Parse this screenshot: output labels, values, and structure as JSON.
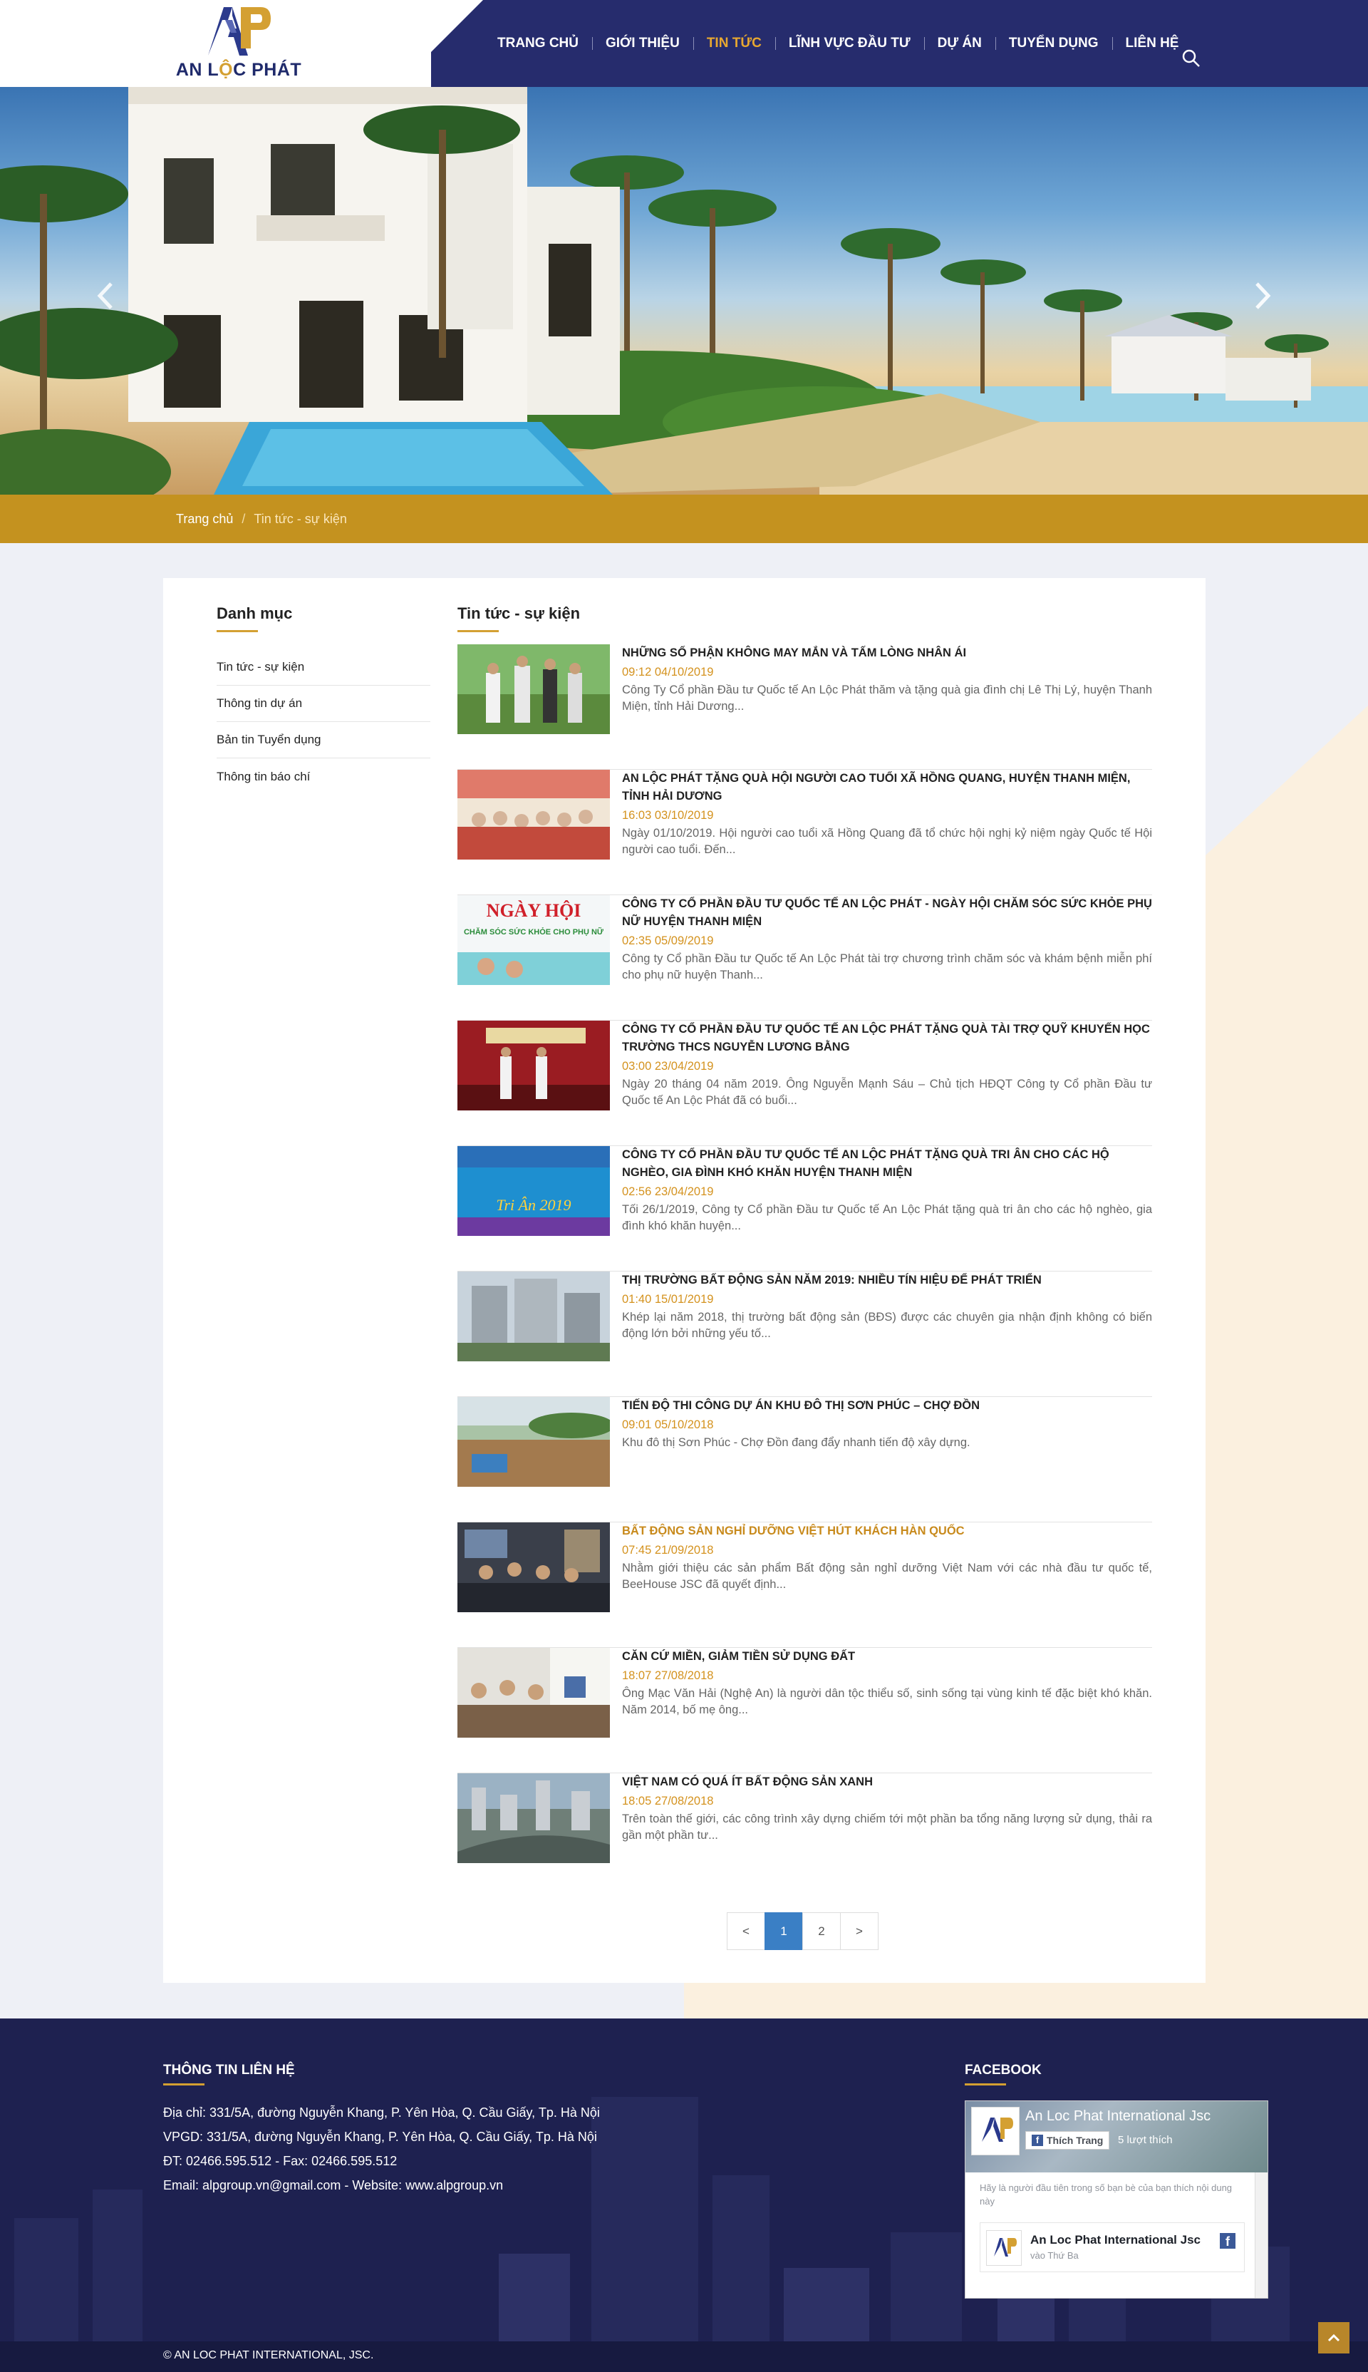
{
  "brand": {
    "logo_text_left": "AN L",
    "logo_text_o": "Ộ",
    "logo_text_right": "C PHÁT"
  },
  "nav": {
    "items": [
      "TRANG CHỦ",
      "GIỚI THIỆU",
      "TIN TỨC",
      "LĨNH VỰC ĐẦU TƯ",
      "DỰ ÁN",
      "TUYỂN DỤNG",
      "LIÊN HỆ"
    ],
    "active": "TIN TỨC",
    "search_icon": "search-icon"
  },
  "hero": {
    "prev_icon": "chevron-left-icon",
    "next_icon": "chevron-right-icon"
  },
  "breadcrumb": {
    "home": "Trang chủ",
    "separator": "/",
    "current": "Tin tức - sự kiện"
  },
  "sidebar": {
    "title": "Danh mục",
    "items": [
      "Tin tức - sự kiện",
      "Thông tin dự án",
      "Bản tin Tuyển dụng",
      "Thông tin báo chí"
    ]
  },
  "main": {
    "title": "Tin tức - sự kiện",
    "news": [
      {
        "title": "NHỮNG SỐ PHẬN KHÔNG MAY MẮN VÀ TẤM LÒNG NHÂN ÁI",
        "date": "09:12 04/10/2019",
        "desc": "Công Ty Cổ phần Đầu tư Quốc tế An Lộc Phát thăm và tặng quà gia đình chị Lê Thị Lý, huyện Thanh Miện, tỉnh Hải Dương..."
      },
      {
        "title": "AN LỘC PHÁT TẶNG QUÀ HỘI NGƯỜI CAO TUỔI XÃ HỒNG QUANG, HUYỆN THANH MIỆN, TỈNH HẢI DƯƠNG",
        "date": "16:03 03/10/2019",
        "desc": "Ngày 01/10/2019. Hội người cao tuổi xã Hồng Quang đã tổ chức hội nghị kỷ niệm ngày Quốc tế Hội người cao tuổi. Đến..."
      },
      {
        "title": "CÔNG TY CỔ PHẦN ĐẦU TƯ QUỐC TẾ AN LỘC PHÁT - NGÀY HỘI CHĂM SÓC SỨC KHỎE PHỤ NỮ HUYỆN THANH MIỆN",
        "date": "02:35 05/09/2019",
        "desc": "Công ty Cổ phần Đầu tư Quốc tế An Lộc Phát tài trợ chương trình chăm sóc và khám bệnh miễn phí cho phụ nữ huyện Thanh..."
      },
      {
        "title": "CÔNG TY CỔ PHẦN ĐẦU TƯ QUỐC TẾ AN LỘC PHÁT TẶNG QUÀ TÀI TRỢ QUỸ KHUYẾN HỌC TRƯỜNG THCS NGUYỄN LƯƠNG BẰNG",
        "date": "03:00 23/04/2019",
        "desc": "Ngày 20 tháng 04 năm 2019. Ông Nguyễn Mạnh Sáu – Chủ tịch HĐQT Công ty Cổ phần Đầu tư Quốc tế An Lộc Phát đã có buổi..."
      },
      {
        "title": "CÔNG TY CỔ PHẦN ĐẦU TƯ QUỐC TẾ AN LỘC PHÁT TẶNG QUÀ TRI ÂN CHO CÁC HỘ NGHÈO, GIA ĐÌNH KHÓ KHĂN HUYỆN THANH MIỆN",
        "date": "02:56 23/04/2019",
        "desc": "Tối 26/1/2019, Công ty Cổ phần Đầu tư Quốc tế An Lộc Phát tặng quà tri ân cho các hộ nghèo, gia đình khó khăn huyện..."
      },
      {
        "title": "THỊ TRƯỜNG BẤT ĐỘNG SẢN NĂM 2019: NHIỀU TÍN HIỆU ĐỂ PHÁT TRIỂN",
        "date": "01:40 15/01/2019",
        "desc": "Khép lại năm 2018, thị trường bất động sản (BĐS) được các chuyên gia nhận định không có biến động lớn bởi những yếu tố..."
      },
      {
        "title": "TIẾN ĐỘ THI CÔNG DỰ ÁN KHU ĐÔ THỊ SƠN PHÚC – CHỢ ĐỒN",
        "date": "09:01 05/10/2018",
        "desc": "Khu đô thị Sơn Phúc - Chợ Đồn đang đẩy nhanh tiến độ xây dựng."
      },
      {
        "title": "BẤT ĐỘNG SẢN NGHỈ DƯỠNG VIỆT HÚT KHÁCH HÀN QUỐC",
        "date": "07:45 21/09/2018",
        "desc": "Nhằm giới thiệu các sản phẩm Bất động sản nghỉ dưỡng Việt Nam với các nhà đầu tư quốc tế, BeeHouse JSC đã quyết định..."
      },
      {
        "title": "CĂN CỨ MIỀN, GIẢM TIỀN SỬ DỤNG ĐẤT",
        "date": "18:07 27/08/2018",
        "desc": "Ông Mạc Văn Hải (Nghệ An) là người dân tộc thiểu số, sinh sống tại vùng kinh tế đặc biệt khó khăn. Năm 2014, bố mẹ ông..."
      },
      {
        "title": "VIỆT NAM CÓ QUÁ ÍT BẤT ĐỘNG SẢN XANH",
        "date": "18:05 27/08/2018",
        "desc": "Trên toàn thế giới, các công trình xây dựng chiếm tới một phần ba tổng năng lượng sử dụng, thải ra gần một phần tư..."
      }
    ]
  },
  "pagination": {
    "prev": "<",
    "pages": [
      "1",
      "2"
    ],
    "current": "1",
    "next": ">"
  },
  "footer": {
    "contact_title": "THÔNG TIN LIÊN HỆ",
    "lines": [
      "Địa chỉ: 331/5A, đường Nguyễn Khang, P. Yên Hòa, Q. Cầu Giấy, Tp. Hà Nội",
      "VPGD: 331/5A, đường Nguyễn Khang, P. Yên Hòa, Q. Cầu Giấy, Tp. Hà Nội",
      "ĐT: 02466.595.512 - Fax: 02466.595.512",
      "Email: alpgroup.vn@gmail.com - Website: www.alpgroup.vn"
    ],
    "facebook_title": "FACEBOOK",
    "fb": {
      "page_name": "An Loc Phat International Jsc",
      "like_label": "Thích Trang",
      "like_count": "5 lượt thích",
      "friends_text": "Hãy là người đầu tiên trong số bạn bè của bạn thích nội dung này",
      "post_name": "An Loc Phat International Jsc",
      "post_time": "vào Thứ Ba"
    },
    "copyright": "© AN LOC PHAT INTERNATIONAL, JSC.",
    "back_top_icon": "chevron-up-icon"
  },
  "colors": {
    "navy": "#262c6d",
    "gold": "#c4921f",
    "accent": "#e8a830",
    "pager_active": "#3a7fc5"
  }
}
